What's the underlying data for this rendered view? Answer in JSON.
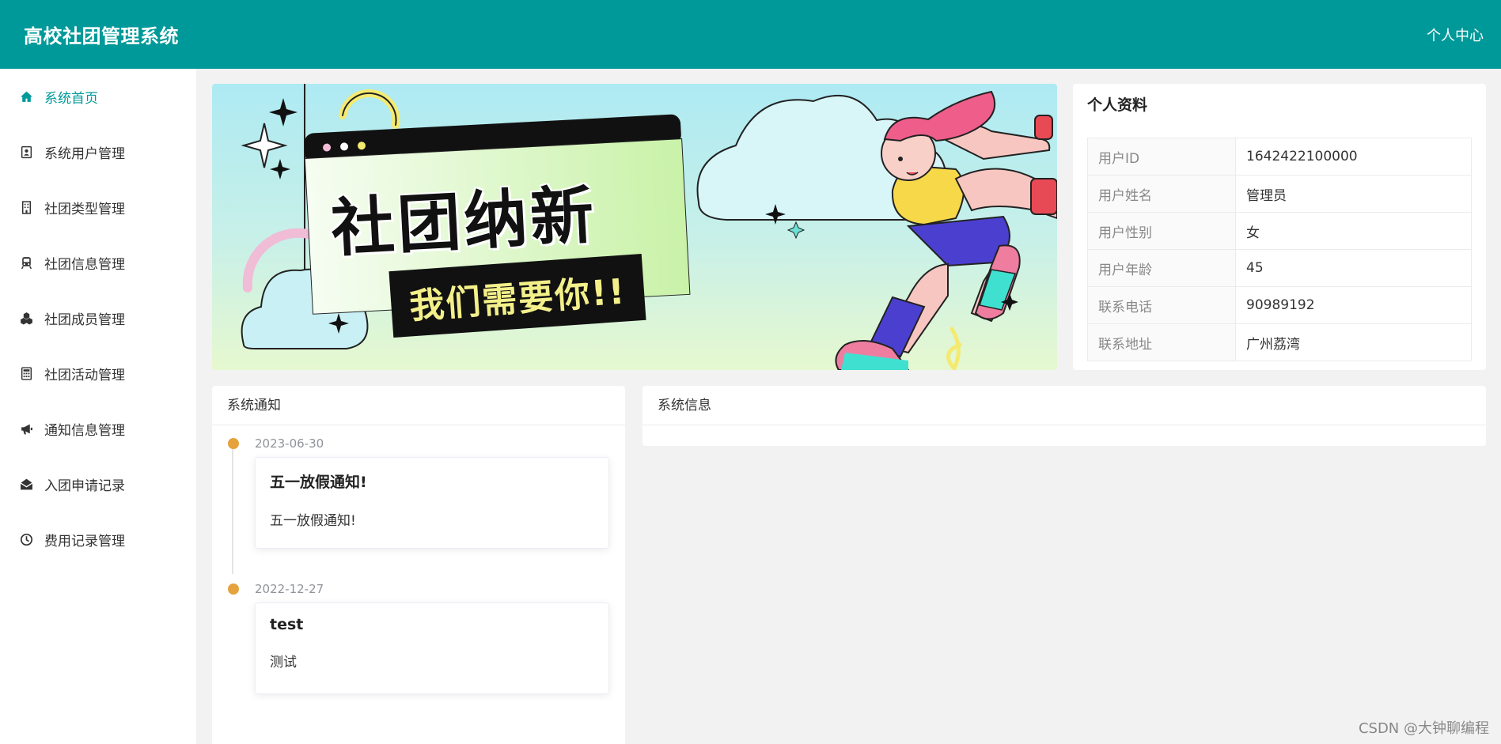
{
  "header": {
    "title": "高校社团管理系统",
    "user_center": "个人中心"
  },
  "sidebar": {
    "items": [
      {
        "label": "系统首页",
        "icon": "home-icon",
        "active": true
      },
      {
        "label": "系统用户管理",
        "icon": "user-card-icon"
      },
      {
        "label": "社团类型管理",
        "icon": "building-icon"
      },
      {
        "label": "社团信息管理",
        "icon": "train-icon"
      },
      {
        "label": "社团成员管理",
        "icon": "cubes-icon"
      },
      {
        "label": "社团活动管理",
        "icon": "calculator-icon"
      },
      {
        "label": "通知信息管理",
        "icon": "bullhorn-icon"
      },
      {
        "label": "入团申请记录",
        "icon": "envelope-open-icon"
      },
      {
        "label": "费用记录管理",
        "icon": "clock-icon"
      }
    ]
  },
  "banner": {
    "headline": "社团纳新",
    "subline": "我们需要你!!"
  },
  "profile": {
    "title": "个人资料",
    "rows": [
      {
        "key": "用户ID",
        "value": "1642422100000"
      },
      {
        "key": "用户姓名",
        "value": "管理员"
      },
      {
        "key": "用户性别",
        "value": "女"
      },
      {
        "key": "用户年龄",
        "value": "45"
      },
      {
        "key": "联系电话",
        "value": "90989192"
      },
      {
        "key": "联系地址",
        "value": "广州荔湾"
      }
    ]
  },
  "notice": {
    "title": "系统通知",
    "items": [
      {
        "date": "2023-06-30",
        "title": "五一放假通知!",
        "content": "五一放假通知!"
      },
      {
        "date": "2022-12-27",
        "title": "test",
        "content": "测试"
      }
    ]
  },
  "sysinfo": {
    "title": "系统信息"
  },
  "watermark": "CSDN @大钟聊编程",
  "colors": {
    "primary": "#009999",
    "timeline_dot": "#e6a23c",
    "background": "#f2f2f2"
  }
}
